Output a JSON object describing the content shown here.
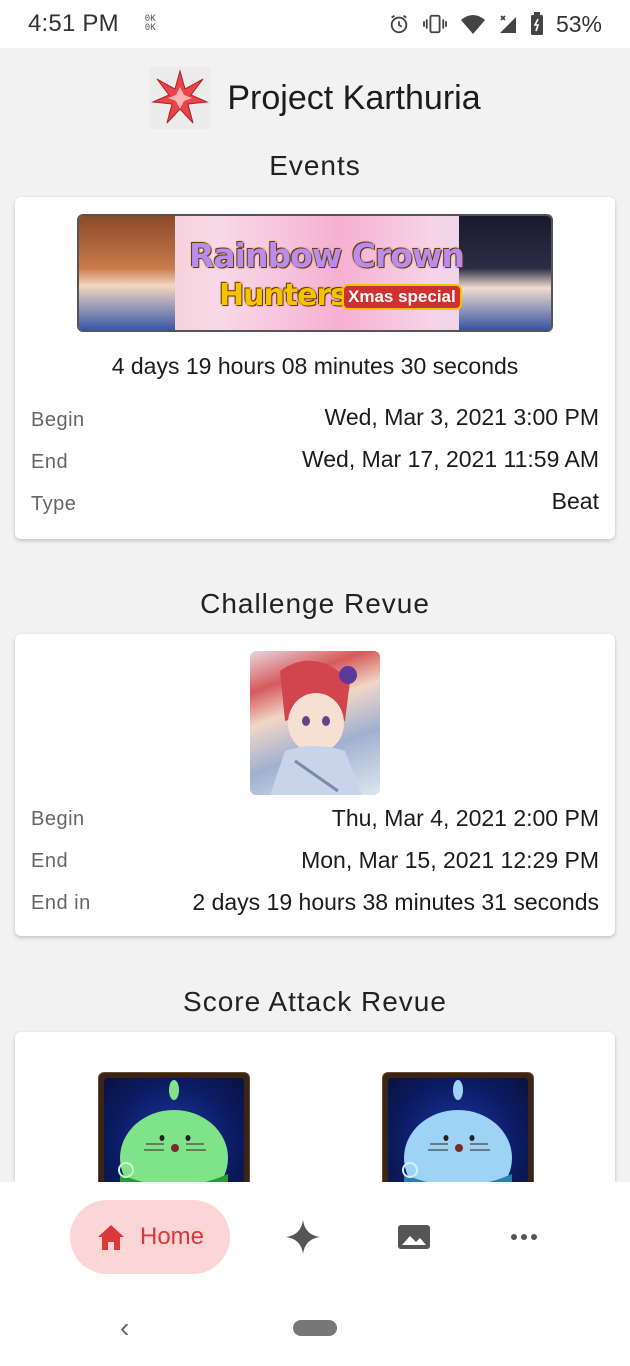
{
  "status_bar": {
    "time": "4:51 PM",
    "ok_glyph": "0K\n0K",
    "battery_percent": "53%",
    "icons": [
      "alarm-icon",
      "vibrate-icon",
      "wifi-icon",
      "signal-icon",
      "battery-icon"
    ]
  },
  "header": {
    "title": "Project Karthuria",
    "logo_icon": "star-burst-icon"
  },
  "events": {
    "section_title": "Events",
    "banner": {
      "line1": "Rainbow Crown",
      "line2": "Hunters",
      "badge": "Xmas special"
    },
    "countdown": "4 days 19 hours 08 minutes 30 seconds",
    "rows": [
      {
        "label": "Begin",
        "value": "Wed, Mar 3, 2021 3:00 PM"
      },
      {
        "label": "End",
        "value": "Wed, Mar 17, 2021 11:59 AM"
      },
      {
        "label": "Type",
        "value": "Beat"
      }
    ]
  },
  "challenge": {
    "section_title": "Challenge Revue",
    "rows": [
      {
        "label": "Begin",
        "value": "Thu, Mar 4, 2021 2:00 PM"
      },
      {
        "label": "End",
        "value": "Mon, Mar 15, 2021 12:29 PM"
      },
      {
        "label": "End in",
        "value": "2 days 19 hours 38 minutes 31 seconds"
      }
    ]
  },
  "score_attack": {
    "section_title": "Score Attack Revue"
  },
  "bottom_nav": {
    "home_label": "Home",
    "items": [
      "home-icon",
      "sparkle-icon",
      "image-icon",
      "more-icon"
    ]
  },
  "colors": {
    "accent": "#d83a3a",
    "accent_bg": "#fcd6d6",
    "background": "#f2f2f2"
  }
}
